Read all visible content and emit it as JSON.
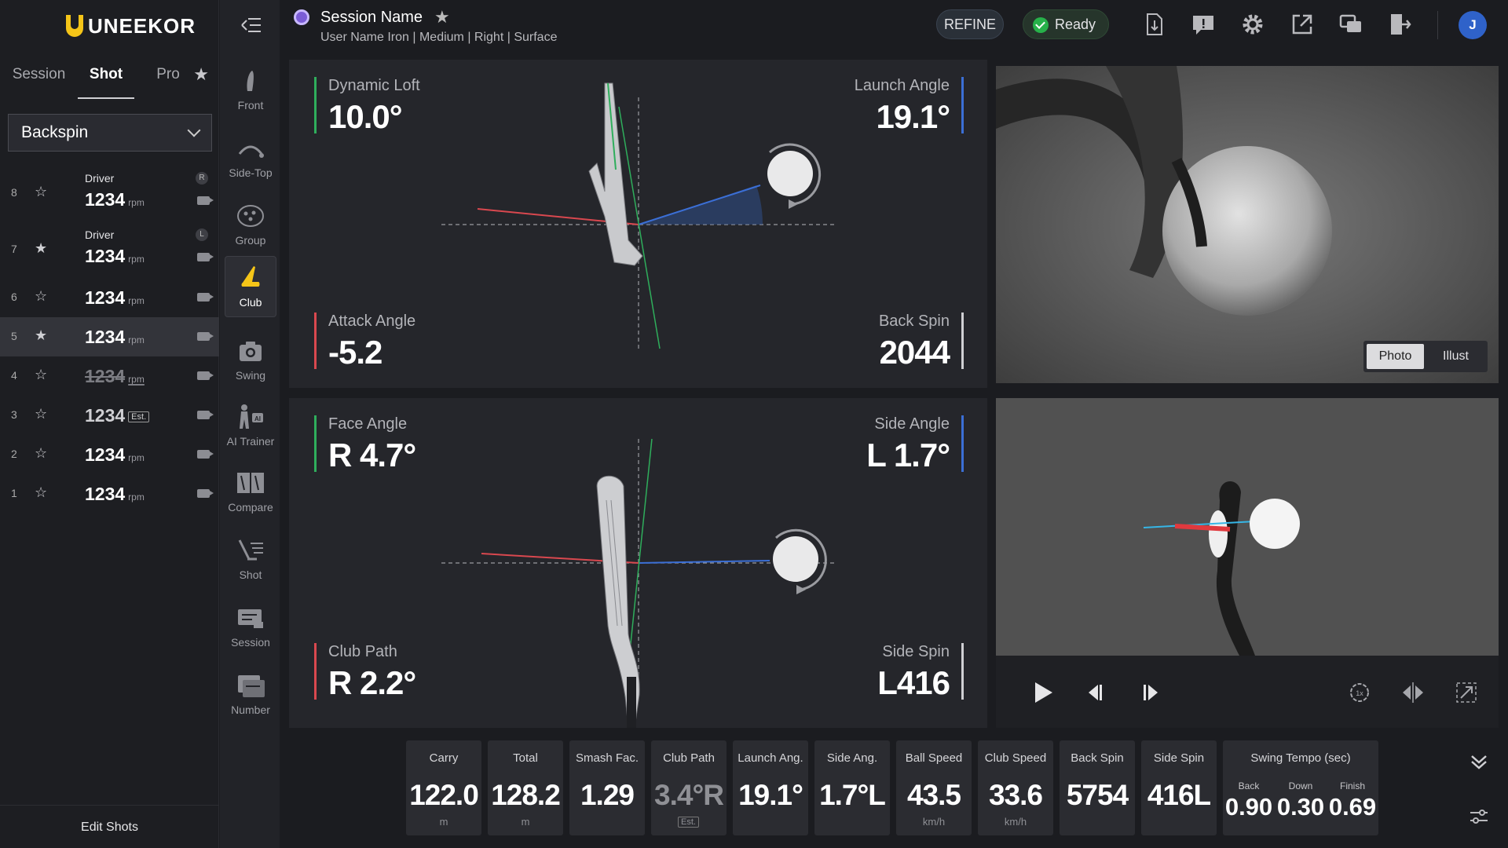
{
  "brand": {
    "logo_text": "UNEEKOR",
    "accent": "#f5c518"
  },
  "left_panel": {
    "tabs": [
      {
        "label": "Session"
      },
      {
        "label": "Shot"
      },
      {
        "label": "Pro"
      }
    ],
    "active_tab": "Shot",
    "metric_select": "Backspin",
    "shots": [
      {
        "num": "8",
        "club": "Driver",
        "value": "1234",
        "unit": "rpm",
        "starred": false,
        "badge": "R"
      },
      {
        "num": "7",
        "club": "Driver",
        "value": "1234",
        "unit": "rpm",
        "starred": true,
        "badge": "L"
      },
      {
        "num": "6",
        "club": "",
        "value": "1234",
        "unit": "rpm",
        "starred": false
      },
      {
        "num": "5",
        "club": "",
        "value": "1234",
        "unit": "rpm",
        "starred": true,
        "selected": true
      },
      {
        "num": "4",
        "club": "",
        "value": "1234",
        "unit": "rpm",
        "starred": false,
        "struck": true
      },
      {
        "num": "3",
        "club": "",
        "value": "1234",
        "unit": "",
        "starred": false,
        "est": "Est."
      },
      {
        "num": "2",
        "club": "",
        "value": "1234",
        "unit": "rpm",
        "starred": false
      },
      {
        "num": "1",
        "club": "",
        "value": "1234",
        "unit": "rpm",
        "starred": false
      }
    ],
    "edit_label": "Edit Shots"
  },
  "tools": [
    {
      "label": "Front",
      "icon": "front-view-icon"
    },
    {
      "label": "Side-Top",
      "icon": "side-top-icon"
    },
    {
      "label": "Group",
      "icon": "group-icon"
    },
    {
      "label": "Club",
      "icon": "club-icon",
      "active": true
    },
    {
      "label": "Swing",
      "icon": "camera-icon"
    },
    {
      "label": "AI Trainer",
      "icon": "ai-trainer-icon"
    },
    {
      "label": "Compare",
      "icon": "compare-icon"
    },
    {
      "label": "Shot",
      "icon": "shot-icon"
    },
    {
      "label": "Session",
      "icon": "session-icon"
    },
    {
      "label": "Number",
      "icon": "number-icon"
    }
  ],
  "header": {
    "session_name": "Session Name",
    "subtitle": "User Name  Iron | Medium | Right | Surface",
    "refine_label": "REFINE",
    "ready_label": "Ready",
    "avatar_initial": "J"
  },
  "club_top": {
    "dynamic_loft": {
      "name": "Dynamic Loft",
      "value": "10.0°",
      "color": "#2fae5c"
    },
    "launch_angle": {
      "name": "Launch Angle",
      "value": "19.1°",
      "color": "#3b6fd6"
    },
    "attack_angle": {
      "name": "Attack Angle",
      "value": "-5.2",
      "color": "#d9484f"
    },
    "back_spin": {
      "name": "Back Spin",
      "value": "2044",
      "color": "#cfcfd3"
    }
  },
  "club_bottom": {
    "face_angle": {
      "name": "Face Angle",
      "value": "R 4.7°",
      "color": "#2fae5c"
    },
    "side_angle": {
      "name": "Side Angle",
      "value": "L 1.7°",
      "color": "#3b6fd6"
    },
    "club_path": {
      "name": "Club Path",
      "value": "R 2.2°",
      "color": "#d9484f"
    },
    "side_spin": {
      "name": "Side Spin",
      "value": "L416",
      "color": "#cfcfd3"
    }
  },
  "photo_toggle": {
    "photo": "Photo",
    "illust": "Illust",
    "selected": "Photo"
  },
  "strip": [
    {
      "title": "Carry",
      "value": "122.0",
      "unit": "m"
    },
    {
      "title": "Total",
      "value": "128.2",
      "unit": "m"
    },
    {
      "title": "Smash Fac.",
      "value": "1.29",
      "unit": ""
    },
    {
      "title": "Club Path",
      "value": "3.4°R",
      "unit": "",
      "est": "Est.",
      "dim": true
    },
    {
      "title": "Launch Ang.",
      "value": "19.1°",
      "unit": ""
    },
    {
      "title": "Side Ang.",
      "value": "1.7°L",
      "unit": ""
    },
    {
      "title": "Ball Speed",
      "value": "43.5",
      "unit": "km/h"
    },
    {
      "title": "Club Speed",
      "value": "33.6",
      "unit": "km/h"
    },
    {
      "title": "Back Spin",
      "value": "5754",
      "unit": ""
    },
    {
      "title": "Side Spin",
      "value": "416L",
      "unit": ""
    }
  ],
  "tempo": {
    "title": "Swing Tempo (sec)",
    "items": [
      {
        "k": "Back",
        "v": "0.90"
      },
      {
        "k": "Down",
        "v": "0.30"
      },
      {
        "k": "Finish",
        "v": "0.69"
      }
    ]
  }
}
